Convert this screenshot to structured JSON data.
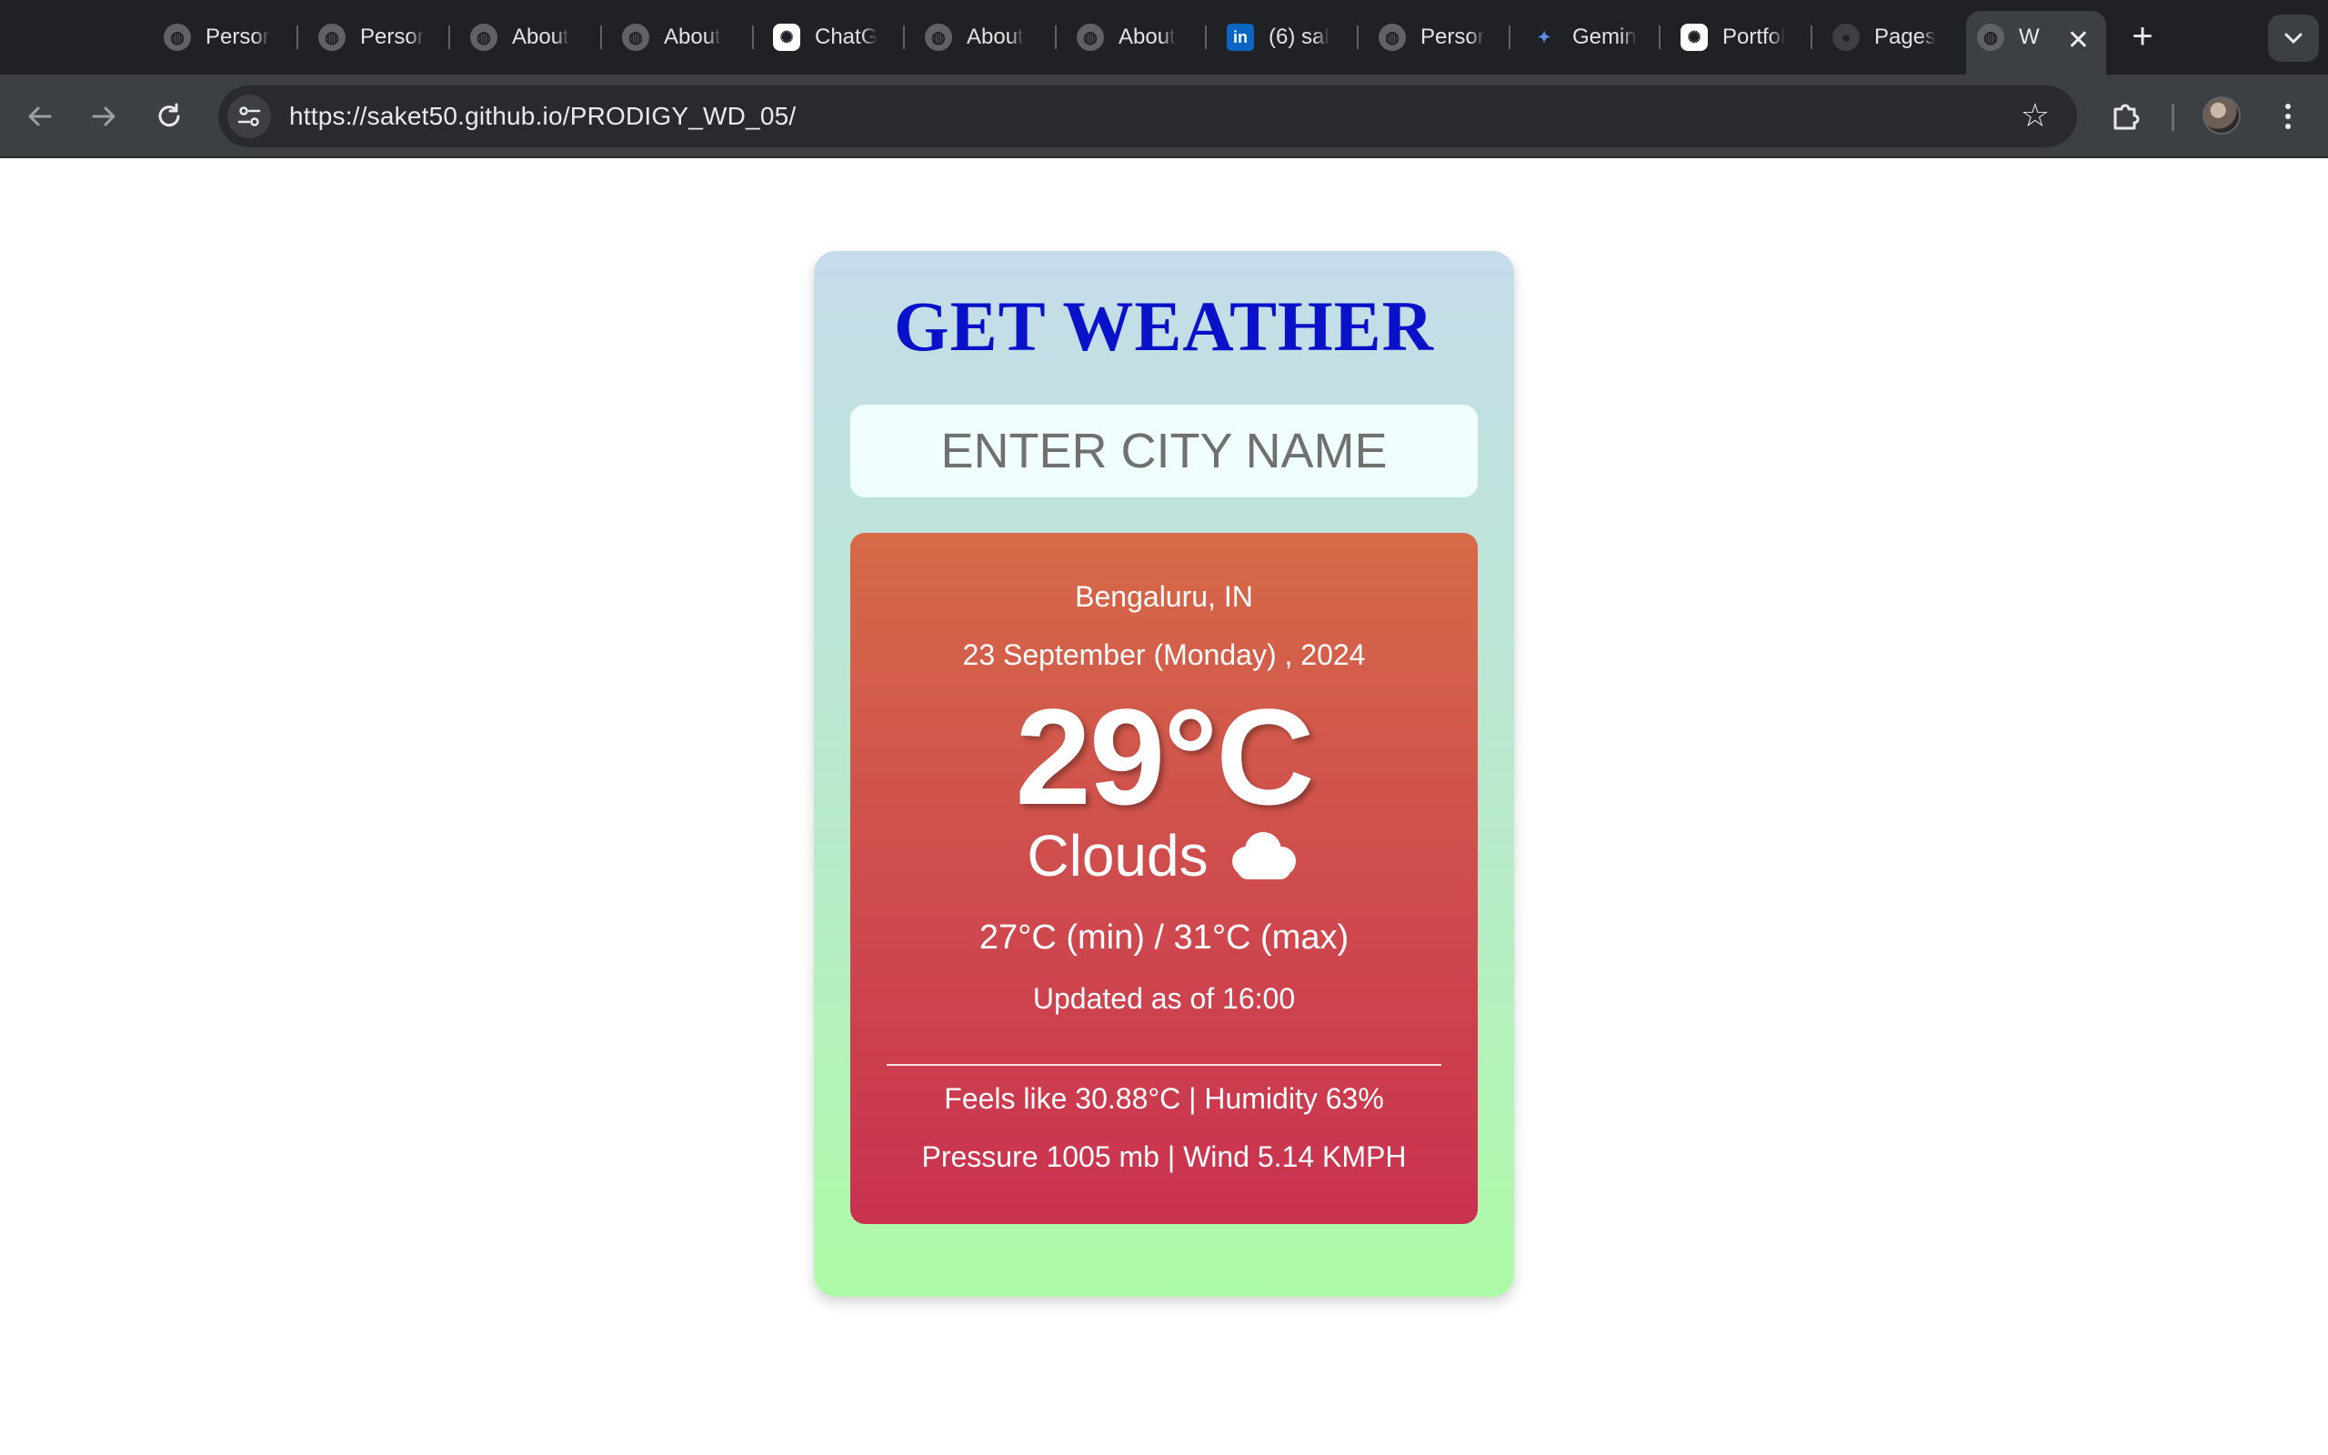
{
  "browser": {
    "tabs": [
      {
        "label": "Persor",
        "icon": "globe-icon"
      },
      {
        "label": "Persor",
        "icon": "globe-icon"
      },
      {
        "label": "About",
        "icon": "globe-icon"
      },
      {
        "label": "About",
        "icon": "globe-icon"
      },
      {
        "label": "ChatG",
        "icon": "chatgpt-icon"
      },
      {
        "label": "About",
        "icon": "globe-icon"
      },
      {
        "label": "About",
        "icon": "globe-icon"
      },
      {
        "label": "(6) sal",
        "icon": "linkedin-icon"
      },
      {
        "label": "Persor",
        "icon": "globe-icon"
      },
      {
        "label": "Gemin",
        "icon": "gemini-icon"
      },
      {
        "label": "Portfol",
        "icon": "chatgpt-icon"
      },
      {
        "label": "Pages",
        "icon": "github-icon"
      },
      {
        "label": "W",
        "icon": "globe-icon",
        "active": true
      }
    ],
    "linkedin_glyph": "in",
    "gemini_glyph": "✦",
    "newtab_glyph": "+",
    "close_glyph": "✕",
    "url": "https://saket50.github.io/PRODIGY_WD_05/"
  },
  "app": {
    "title": "GET WEATHER",
    "input_placeholder": "ENTER CITY NAME",
    "input_value": ""
  },
  "weather": {
    "location": "Bengaluru, IN",
    "date": "23 September (Monday) , 2024",
    "temperature": "29°C",
    "condition": "Clouds",
    "condition_icon": "cloud-icon",
    "min_max": "27°C (min) / 31°C (max)",
    "updated": "Updated as of 16:00",
    "feels_humidity": "Feels like 30.88°C | Humidity 63%",
    "pressure_wind": "Pressure 1005 mb | Wind 5.14 KMPH"
  },
  "colors": {
    "title": "#0a12c9",
    "card_top": "#d66a47",
    "card_bottom": "#c9314f",
    "container_top": "#c5dcea",
    "container_bottom": "#adfba6"
  }
}
